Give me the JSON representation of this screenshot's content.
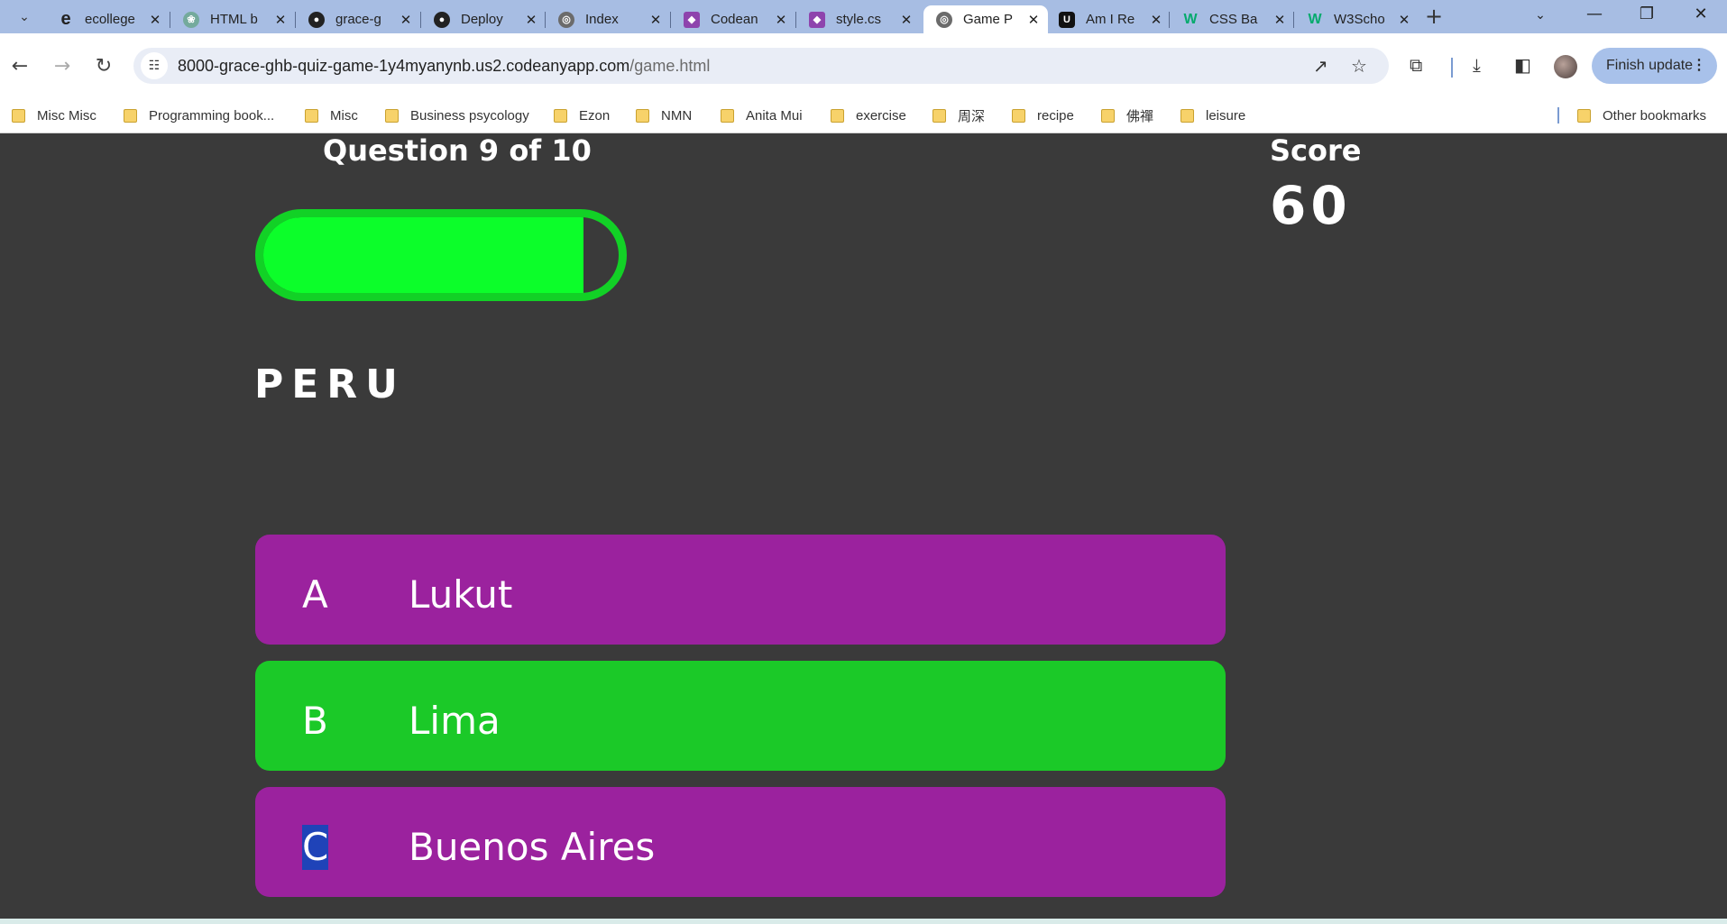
{
  "tabs": [
    {
      "label": "ecollege",
      "icon": "edge-icon",
      "active": false
    },
    {
      "label": "HTML b",
      "icon": "chatgpt-icon",
      "active": false
    },
    {
      "label": "grace-g",
      "icon": "github-icon",
      "active": false
    },
    {
      "label": "Deploy",
      "icon": "github-icon",
      "active": false
    },
    {
      "label": "Index",
      "icon": "globe-icon",
      "active": false
    },
    {
      "label": "Codean",
      "icon": "codeanywhere-icon",
      "active": false
    },
    {
      "label": "style.cs",
      "icon": "codeanywhere-icon",
      "active": false
    },
    {
      "label": "Game P",
      "icon": "globe-icon",
      "active": true
    },
    {
      "label": "Am I Re",
      "icon": "amiresponsive-icon",
      "active": false
    },
    {
      "label": "CSS Ba",
      "icon": "w3schools-icon",
      "active": false
    },
    {
      "label": "W3Scho",
      "icon": "w3schools-icon",
      "active": false
    }
  ],
  "toolbar": {
    "url_host": "8000-grace-ghb-quiz-game-1y4myanynb.us2.codeanyapp.com",
    "url_path": "/game.html",
    "finish_update": "Finish update"
  },
  "bookmarks": [
    {
      "label": "Misc Misc"
    },
    {
      "label": "Programming book..."
    },
    {
      "label": "Misc"
    },
    {
      "label": "Business psycology"
    },
    {
      "label": "Ezon"
    },
    {
      "label": "NMN"
    },
    {
      "label": "Anita Mui"
    },
    {
      "label": "exercise"
    },
    {
      "label": "周深"
    },
    {
      "label": "recipe"
    },
    {
      "label": "佛禪"
    },
    {
      "label": "leisure"
    }
  ],
  "other_bookmarks": "Other bookmarks",
  "game": {
    "progress_text": "Question 9 of 10",
    "progress_fraction": 0.9,
    "score_label": "Score",
    "score_value": "60",
    "question": "PERU",
    "choices": [
      {
        "prefix": "A",
        "text": "Lukut",
        "state": "default"
      },
      {
        "prefix": "B",
        "text": "Lima",
        "state": "correct"
      },
      {
        "prefix": "C",
        "text": "Buenos Aires",
        "state": "default"
      }
    ]
  },
  "colors": {
    "background": "#3a3a3a",
    "choice": "#9b229e",
    "correct": "#1bc928",
    "progress_fill": "#0cfe2a",
    "progress_border": "#12d126"
  }
}
